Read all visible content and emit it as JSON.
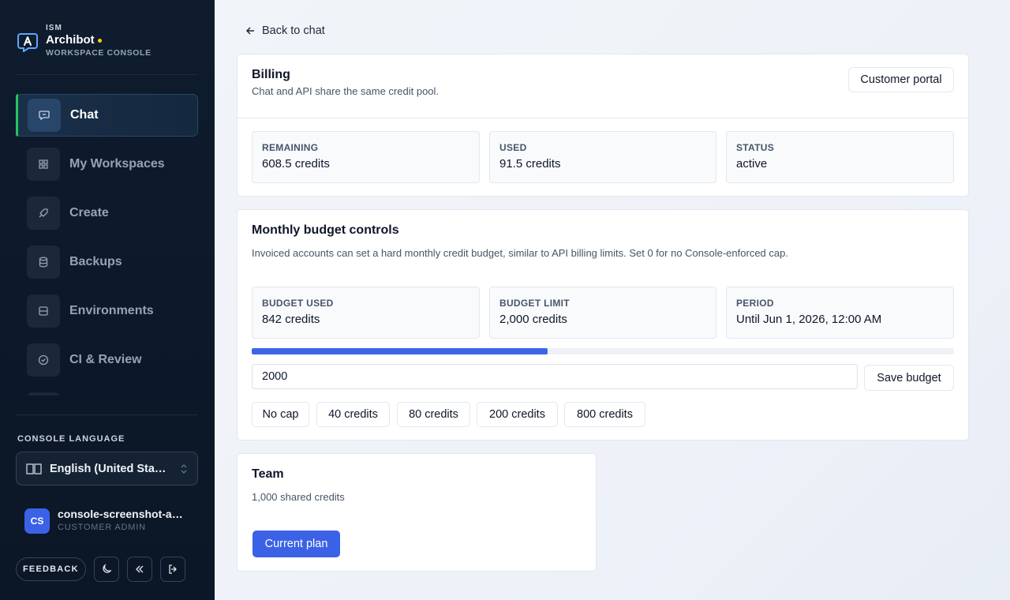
{
  "brand": {
    "org": "ISM",
    "name": "Archibot",
    "subtitle": "WORKSPACE CONSOLE",
    "dot_color": "#facc15"
  },
  "sidebar": {
    "items": [
      {
        "label": "Chat",
        "icon": "chat-icon",
        "active": true
      },
      {
        "label": "My Workspaces",
        "icon": "workspaces-icon",
        "active": false
      },
      {
        "label": "Create",
        "icon": "rocket-icon",
        "active": false
      },
      {
        "label": "Backups",
        "icon": "database-icon",
        "active": false
      },
      {
        "label": "Environments",
        "icon": "server-icon",
        "active": false
      },
      {
        "label": "CI & Review",
        "icon": "check-circle-icon",
        "active": false
      }
    ],
    "language": {
      "heading": "CONSOLE LANGUAGE",
      "value": "English (United States)"
    },
    "user": {
      "initials": "CS",
      "name": "console-screenshot-admin",
      "role": "CUSTOMER ADMIN"
    },
    "footer": {
      "feedback_label": "FEEDBACK"
    }
  },
  "main": {
    "back_label": "Back to chat",
    "billing": {
      "title": "Billing",
      "description": "Chat and API share the same credit pool.",
      "portal_label": "Customer portal",
      "stats": [
        {
          "label": "REMAINING",
          "value": "608.5 credits"
        },
        {
          "label": "USED",
          "value": "91.5 credits"
        },
        {
          "label": "STATUS",
          "value": "active"
        }
      ]
    },
    "budget": {
      "title": "Monthly budget controls",
      "description": "Invoiced accounts can set a hard monthly credit budget, similar to API billing limits. Set 0 for no Console‑enforced cap.",
      "stats": [
        {
          "label": "BUDGET USED",
          "value": "842 credits"
        },
        {
          "label": "BUDGET LIMIT",
          "value": "2,000 credits"
        },
        {
          "label": "PERIOD",
          "value": "Until Jun 1, 2026, 12:00 AM"
        }
      ],
      "progress_fraction": 0.421,
      "input_value": "2000",
      "save_label": "Save budget",
      "presets": [
        "No cap",
        "40 credits",
        "80 credits",
        "200 credits",
        "800 credits"
      ]
    },
    "team": {
      "title": "Team",
      "description": "1,000 shared credits",
      "button_label": "Current plan"
    }
  },
  "colors": {
    "accent": "#3b62e6",
    "active_marker": "#22c55e",
    "sidebar_bg": "#0f1c2e"
  }
}
